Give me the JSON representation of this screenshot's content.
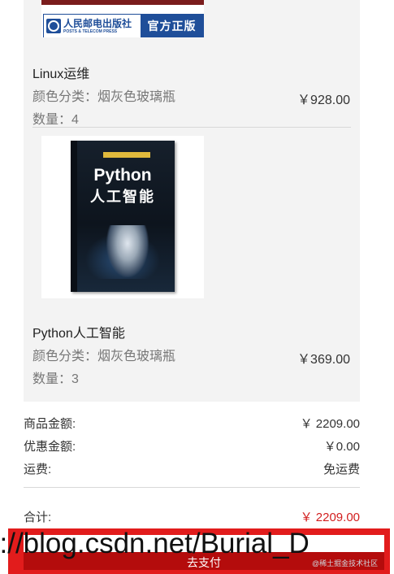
{
  "publisher_banner": {
    "cn": "人民邮电出版社",
    "en": "POSTS & TELECOM PRESS",
    "official": "官方正版"
  },
  "products": [
    {
      "name": "Linux运维",
      "attr": "颜色分类：烟灰色玻璃瓶",
      "qty": "数量：4",
      "price": "￥928.00"
    },
    {
      "name": "Python人工智能",
      "attr": "颜色分类：烟灰色玻璃瓶",
      "qty": "数量：3",
      "price": "￥369.00",
      "cover": {
        "title": "Python",
        "subtitle": "人工智能"
      }
    }
  ],
  "summary": {
    "goods_label": "商品金额:",
    "goods_value": "￥ 2209.00",
    "discount_label": "优惠金额:",
    "discount_value": "￥0.00",
    "shipping_label": "运费:",
    "shipping_value": "免运费",
    "total_label": "合计:",
    "total_value": "￥ 2209.00"
  },
  "checkout": {
    "pay_label": "去支付"
  },
  "overlay": {
    "watermark": "s://blog.csdn.net/Burial_D",
    "credit": "@稀土掘金技术社区"
  },
  "colors": {
    "accent": "#e21c1c",
    "total_price": "#d21e1e",
    "card_bg": "#f3f3f3",
    "publisher_blue": "#1f4e99"
  }
}
